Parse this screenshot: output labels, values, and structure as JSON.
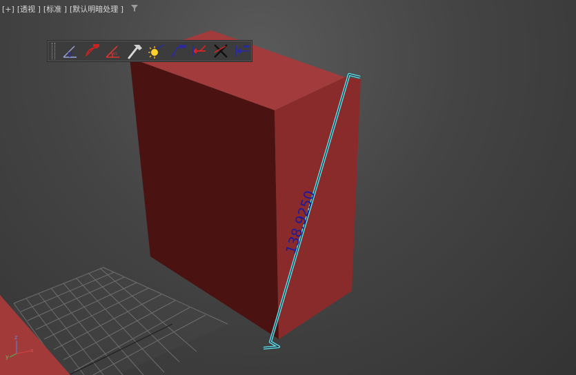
{
  "viewport": {
    "label_plus": "[+]",
    "label_view": "[透视 ]",
    "label_shading": "[标准 ]",
    "label_lighting": "[默认明暗处理 ]"
  },
  "dimension": {
    "value_text": "138.9250",
    "color": "#1a1aa0",
    "outline_color": "#5fe3ea"
  },
  "box": {
    "top_color": "#a23c3c",
    "left_color": "#4b1212",
    "right_color": "#8a2b2b"
  },
  "toolbar": {
    "buttons": [
      {
        "name": "angle-dimension-tool",
        "icon": "angle-icon"
      },
      {
        "name": "radius-dimension-tool",
        "icon": "radius-icon"
      },
      {
        "name": "angle-red-tool",
        "icon": "angle-red-icon"
      },
      {
        "name": "hammer-tool",
        "icon": "hammer-icon"
      },
      {
        "name": "light-tool",
        "icon": "sun-icon"
      },
      {
        "name": "arrow-dimension-tool",
        "icon": "arrow-icon"
      },
      {
        "name": "leader-tool",
        "icon": "leader-icon"
      },
      {
        "name": "delete-dimension-tool",
        "icon": "cross-icon"
      },
      {
        "name": "arrow-left-tool",
        "icon": "arrow-left-icon"
      }
    ]
  }
}
